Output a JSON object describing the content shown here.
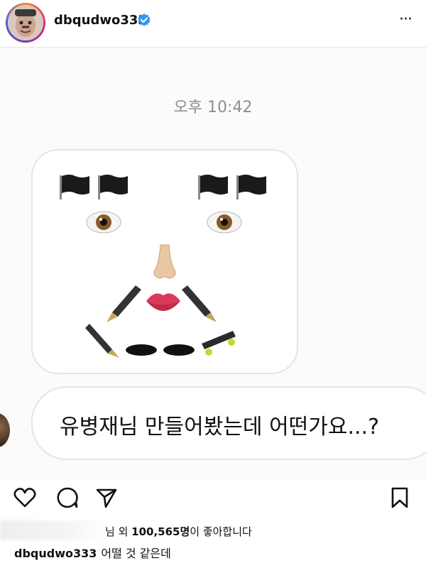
{
  "header": {
    "username": "dbqudwo333",
    "verified_icon": "verified-badge-icon",
    "more_icon": "more-options-icon",
    "more_label": "···"
  },
  "post": {
    "timestamp": "오후 10:42",
    "emoji_face": [
      "black-flag",
      "black-flag",
      "black-flag",
      "black-flag",
      "eye",
      "eye",
      "nose",
      "mouth",
      "fountain-pen",
      "fountain-pen",
      "fountain-pen",
      "hole",
      "hole",
      "skateboard"
    ],
    "message": "유병재님 만들어봤는데 어떤가요...?"
  },
  "actions": {
    "like_icon": "heart-icon",
    "comment_icon": "comment-icon",
    "share_icon": "send-icon",
    "save_icon": "bookmark-icon"
  },
  "likes": {
    "prefix": "님 외 ",
    "count": "100,565명",
    "suffix": "이 좋아합니다"
  },
  "caption": {
    "username": "dbqudwo333",
    "text": "어떨 것 같은데"
  },
  "colors": {
    "verified": "#3897f0",
    "timestamp": "#8e8e93",
    "bubble_border": "#e5e5e5"
  }
}
